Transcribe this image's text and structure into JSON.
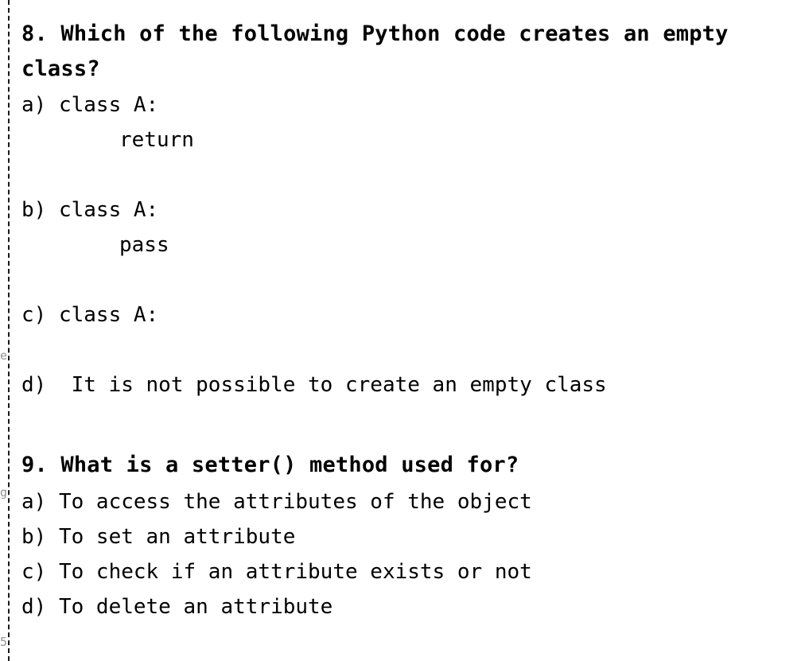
{
  "document": {
    "background_color": "#ffffff",
    "text_color": "#000000",
    "margin_rule_color": "#1a1a1a"
  },
  "edge_bleed": {
    "fragment_1": "e",
    "fragment_2": "g",
    "fragment_3": "5"
  },
  "questions": [
    {
      "number": "8",
      "heading": "8. Which of the following Python code creates an empty class?",
      "options": [
        {
          "label": "a) class A:",
          "code": "return"
        },
        {
          "label": "b) class A:",
          "code": "pass"
        },
        {
          "label": "c) class A:",
          "code": ""
        },
        {
          "label": "d)  It is not possible to create an empty class",
          "code": ""
        }
      ]
    },
    {
      "number": "9",
      "heading": "9. What is a setter() method used for?",
      "options": [
        {
          "label": "a) To access the attributes of the object",
          "code": ""
        },
        {
          "label": "b) To set an attribute",
          "code": ""
        },
        {
          "label": "c) To check if an attribute exists or not",
          "code": ""
        },
        {
          "label": "d) To delete an attribute",
          "code": ""
        }
      ]
    }
  ]
}
